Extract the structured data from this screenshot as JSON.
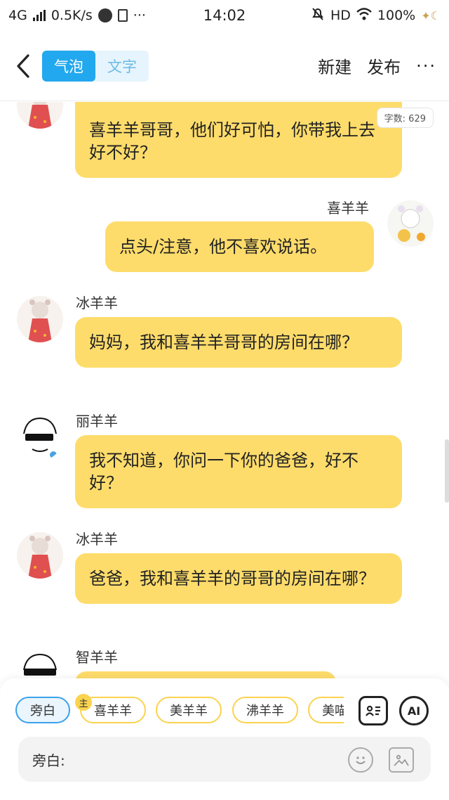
{
  "status": {
    "network": "4G",
    "speed": "0.5K/s",
    "time": "14:02",
    "hd": "HD",
    "battery": "100%"
  },
  "nav": {
    "tab_bubble": "气泡",
    "tab_text": "文字",
    "new_label": "新建",
    "publish_label": "发布",
    "more_label": "···"
  },
  "word_count": "字数: 629",
  "messages": [
    {
      "speaker": "",
      "text": "喜羊羊哥哥，他们好可怕，你带我上去好不好？"
    },
    {
      "speaker": "喜羊羊",
      "text": "点头/注意，他不喜欢说话。"
    },
    {
      "speaker": "冰羊羊",
      "text": "妈妈，我和喜羊羊哥哥的房间在哪？"
    },
    {
      "speaker": "丽羊羊",
      "text": "我不知道，你问一下你的爸爸，好不好？"
    },
    {
      "speaker": "冰羊羊",
      "text": "爸爸，我和喜羊羊的哥哥的房间在哪？"
    },
    {
      "speaker": "智羊羊",
      "text": ""
    }
  ],
  "roles": [
    "旁白",
    "喜羊羊",
    "美羊羊",
    "沸羊羊",
    "美喵"
  ],
  "main_tag": "主",
  "ai_label": "AI",
  "input_label": "旁白:",
  "colors": {
    "accent": "#22a8ee",
    "bubble": "#fedc6b",
    "chip_border": "#fad34f"
  }
}
